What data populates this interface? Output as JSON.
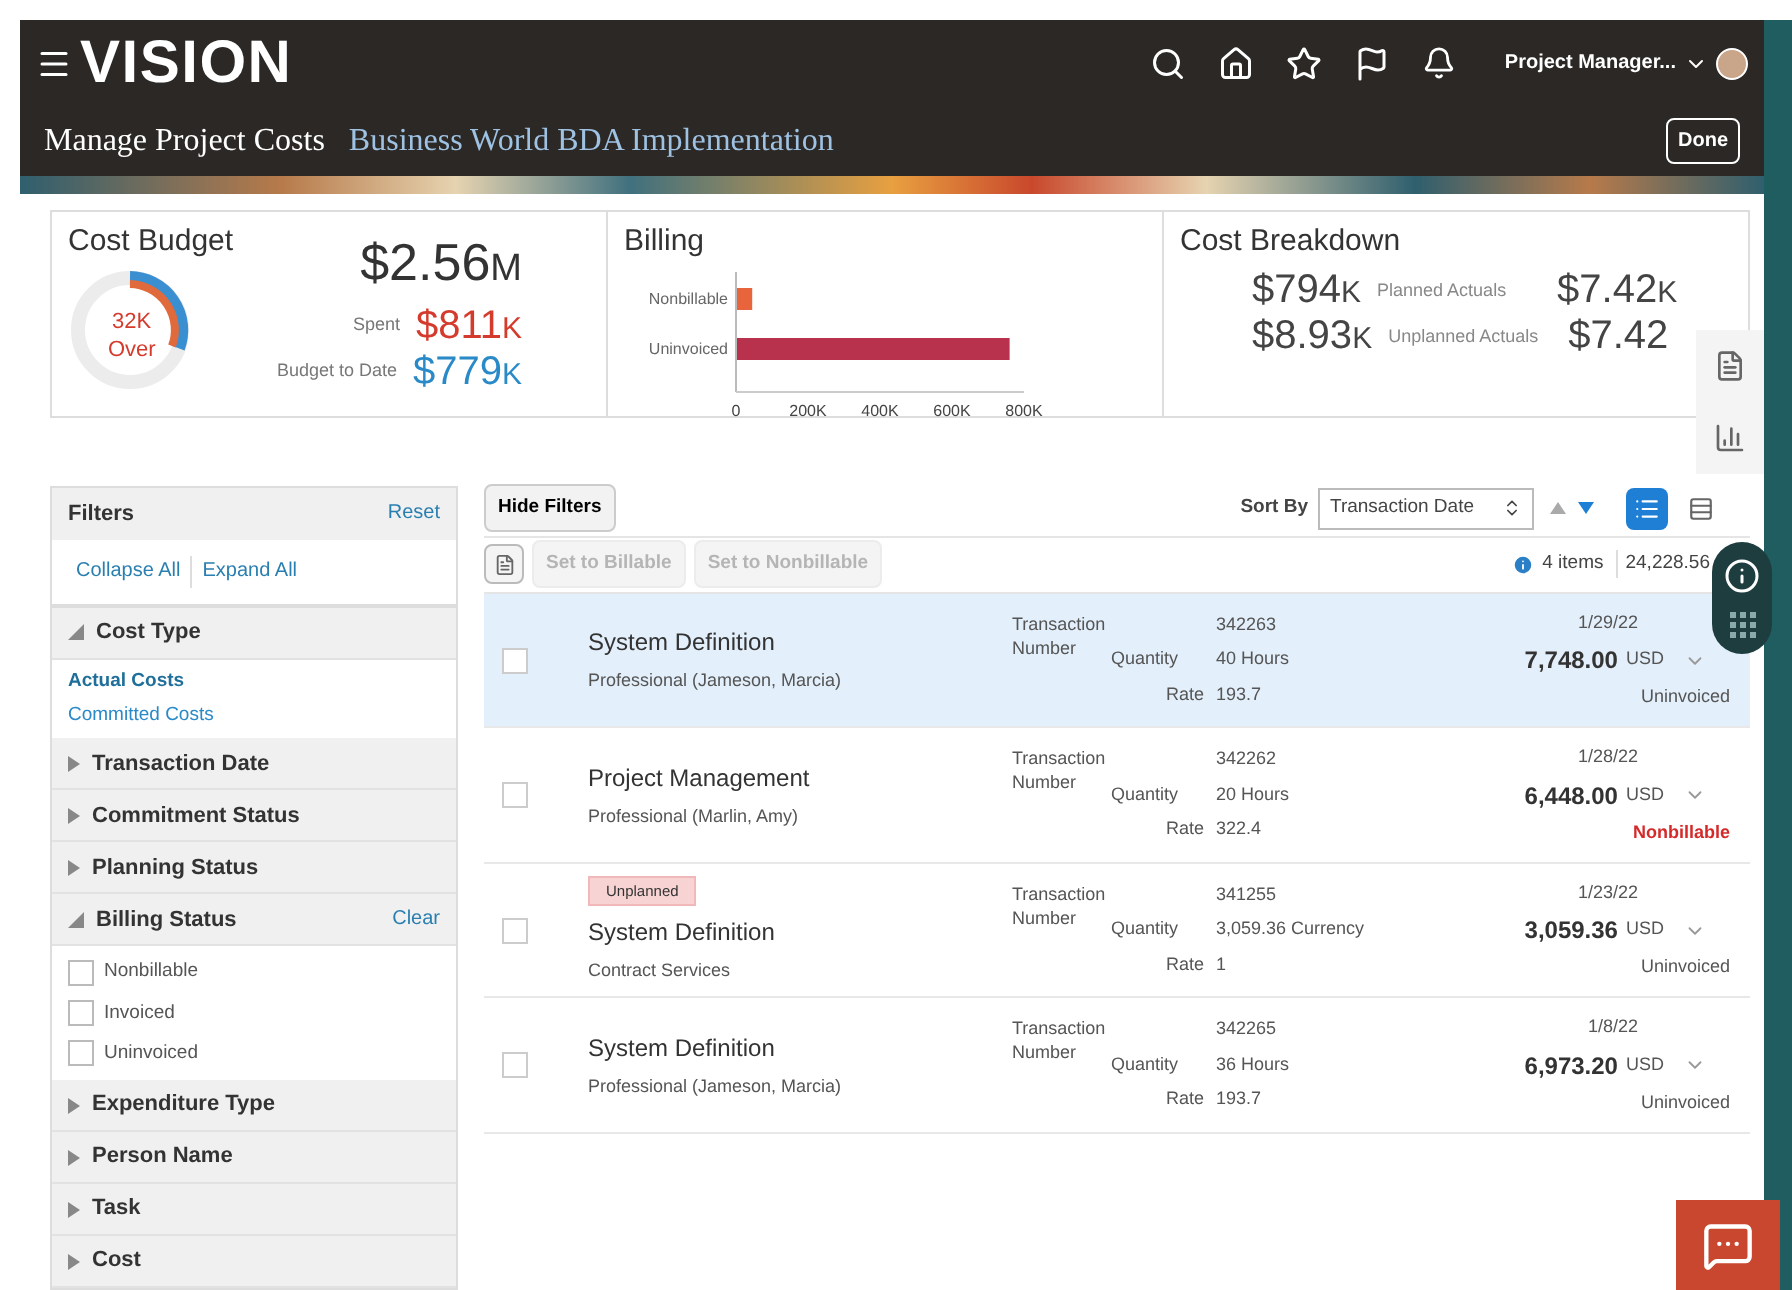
{
  "header": {
    "logo": "VISION",
    "user": "Project Manager..."
  },
  "subheader": {
    "title": "Manage Project Costs",
    "project": "Business World BDA Implementation",
    "done": "Done"
  },
  "cost_budget": {
    "title": "Cost Budget",
    "donut_value": "32K",
    "donut_label": "Over",
    "total": "$2.56",
    "total_unit": "M",
    "spent_label": "Spent",
    "spent": "$811",
    "spent_unit": "K",
    "budget_label": "Budget to Date",
    "budget": "$779",
    "budget_unit": "K"
  },
  "billing": {
    "title": "Billing",
    "chart_data": {
      "type": "bar",
      "orientation": "horizontal",
      "categories": [
        "Nonbillable",
        "Uninvoiced"
      ],
      "values": [
        45000,
        760000
      ],
      "xlim": [
        0,
        800000
      ],
      "xticks": [
        {
          "value": 0,
          "label": "0"
        },
        {
          "value": 200000,
          "label": "200K"
        },
        {
          "value": 400000,
          "label": "400K"
        },
        {
          "value": 600000,
          "label": "600K"
        },
        {
          "value": 800000,
          "label": "800K"
        }
      ]
    }
  },
  "cost_breakdown": {
    "title": "Cost Breakdown",
    "rows": [
      {
        "value": "$794",
        "unit": "K",
        "label": "Planned Actuals",
        "value_2": "$7.42",
        "unit_2": "K"
      },
      {
        "value": "$8.93",
        "unit": "K",
        "label": "Unplanned Actuals",
        "value_2": "$7.42",
        "unit_2": ""
      }
    ]
  },
  "filters": {
    "title": "Filters",
    "reset": "Reset",
    "collapse_all": "Collapse All",
    "expand_all": "Expand All",
    "sections": [
      {
        "label": "Cost Type",
        "expanded": true,
        "kind": "links",
        "items": [
          {
            "label": "Actual Costs",
            "selected": true
          },
          {
            "label": "Committed Costs",
            "selected": false
          }
        ]
      },
      {
        "label": "Transaction Date",
        "expanded": false
      },
      {
        "label": "Commitment Status",
        "expanded": false
      },
      {
        "label": "Planning Status",
        "expanded": false
      },
      {
        "label": "Billing Status",
        "expanded": true,
        "action": "Clear",
        "kind": "checkboxes",
        "items": [
          {
            "label": "Nonbillable",
            "checked": false
          },
          {
            "label": "Invoiced",
            "checked": false
          },
          {
            "label": "Uninvoiced",
            "checked": false
          }
        ]
      },
      {
        "label": "Expenditure Type",
        "expanded": false
      },
      {
        "label": "Person Name",
        "expanded": false
      },
      {
        "label": "Task",
        "expanded": false
      },
      {
        "label": "Cost",
        "expanded": false
      }
    ]
  },
  "toolbar": {
    "hide_filters": "Hide Filters",
    "sort_by_label": "Sort By",
    "sort_by": "Transaction Date",
    "sort_ascending": {
      "selected": false
    },
    "sort_descending": {
      "selected": true
    },
    "views": [
      {
        "kind": "list",
        "selected": true
      },
      {
        "kind": "table",
        "selected": false
      }
    ],
    "actions": [
      {
        "label": "Set to Billable",
        "disabled": true
      },
      {
        "label": "Set to Nonbillable",
        "disabled": true
      }
    ],
    "count": "4 items",
    "total": "24,228.56"
  },
  "rows": [
    {
      "selected": true,
      "checked": false,
      "title": "System Definition",
      "subtitle": "Professional (Jameson, Marcia)",
      "number_label": "Transaction Number",
      "number": "342263",
      "quantity_label": "Quantity",
      "quantity": "40 Hours",
      "rate_label": "Rate",
      "rate": "193.7",
      "date": "1/29/22",
      "amount": "7,748.00",
      "currency": "USD",
      "status": "Uninvoiced",
      "alert": false
    },
    {
      "selected": false,
      "checked": false,
      "title": "Project Management",
      "subtitle": "Professional (Marlin, Amy)",
      "number_label": "Transaction Number",
      "number": "342262",
      "quantity_label": "Quantity",
      "quantity": "20 Hours",
      "rate_label": "Rate",
      "rate": "322.4",
      "date": "1/28/22",
      "amount": "6,448.00",
      "currency": "USD",
      "status": "Nonbillable",
      "alert": true
    },
    {
      "selected": false,
      "checked": false,
      "badge": "Unplanned",
      "title": "System Definition",
      "subtitle": "Contract Services",
      "number_label": "Transaction Number",
      "number": "341255",
      "quantity_label": "Quantity",
      "quantity": "3,059.36 Currency",
      "rate_label": "Rate",
      "rate": "1",
      "date": "1/23/22",
      "amount": "3,059.36",
      "currency": "USD",
      "status": "Uninvoiced",
      "alert": false
    },
    {
      "selected": false,
      "checked": false,
      "title": "System Definition",
      "subtitle": "Professional (Jameson, Marcia)",
      "number_label": "Transaction Number",
      "number": "342265",
      "quantity_label": "Quantity",
      "quantity": "36 Hours",
      "rate_label": "Rate",
      "rate": "193.7",
      "date": "1/8/22",
      "amount": "6,973.20",
      "currency": "USD",
      "status": "Uninvoiced",
      "alert": false
    }
  ]
}
